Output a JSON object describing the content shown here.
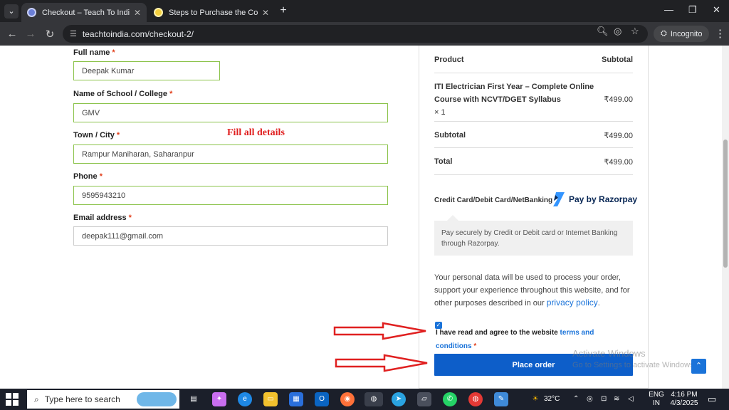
{
  "browser": {
    "tabs": [
      {
        "title": "Checkout – Teach To India",
        "active": true
      },
      {
        "title": "Steps to Purchase the Course -",
        "active": false
      }
    ],
    "url": "teachtoindia.com/checkout-2/",
    "incognito_label": "Incognito"
  },
  "form": {
    "required_mark": "*",
    "fields": [
      {
        "label": "Full name",
        "value": "Deepak Kumar"
      },
      {
        "label": "Name of School / College",
        "value": "GMV"
      },
      {
        "label": "Town / City",
        "value": "Rampur Maniharan, Saharanpur"
      },
      {
        "label": "Phone",
        "value": "9595943210"
      },
      {
        "label": "Email address",
        "value": "deepak111@gmail.com"
      }
    ],
    "annotation": "Fill all details"
  },
  "order": {
    "col_product": "Product",
    "col_subtotal": "Subtotal",
    "item_name_line1": "ITI Electrician First Year – Complete Online",
    "item_name_line2": "Course with NCVT/DGET Syllabus",
    "item_qty": "× 1",
    "item_price": "₹499.00",
    "subtotal_label": "Subtotal",
    "subtotal_value": "₹499.00",
    "total_label": "Total",
    "total_value": "₹499.00"
  },
  "payment": {
    "method_label": "Credit Card/Debit Card/NetBanking",
    "brand": "Pay by Razorpay",
    "description": "Pay securely by Credit or Debit card or Internet Banking through Razorpay."
  },
  "privacy": {
    "text": "Your personal data will be used to process your order, support your experience throughout this website, and for other purposes described in our ",
    "link": "privacy policy",
    "end": "."
  },
  "terms": {
    "text": "I have read and agree to the website ",
    "link": "terms and conditions",
    "required": "*"
  },
  "place_order_label": "Place order",
  "watermark": {
    "line1": "Activate Windows",
    "line2": "Go to Settings to activate Windows."
  },
  "taskbar": {
    "search_placeholder": "Type here to search",
    "temperature": "32°C",
    "lang_top": "ENG",
    "lang_bottom": "IN",
    "time": "4:16 PM",
    "date": "4/3/2025"
  },
  "colors": {
    "accent": "#0d5ec9",
    "link": "#1a73d9",
    "valid_border": "#8bc34a",
    "required": "#e2401c",
    "annotation": "#e02020"
  }
}
